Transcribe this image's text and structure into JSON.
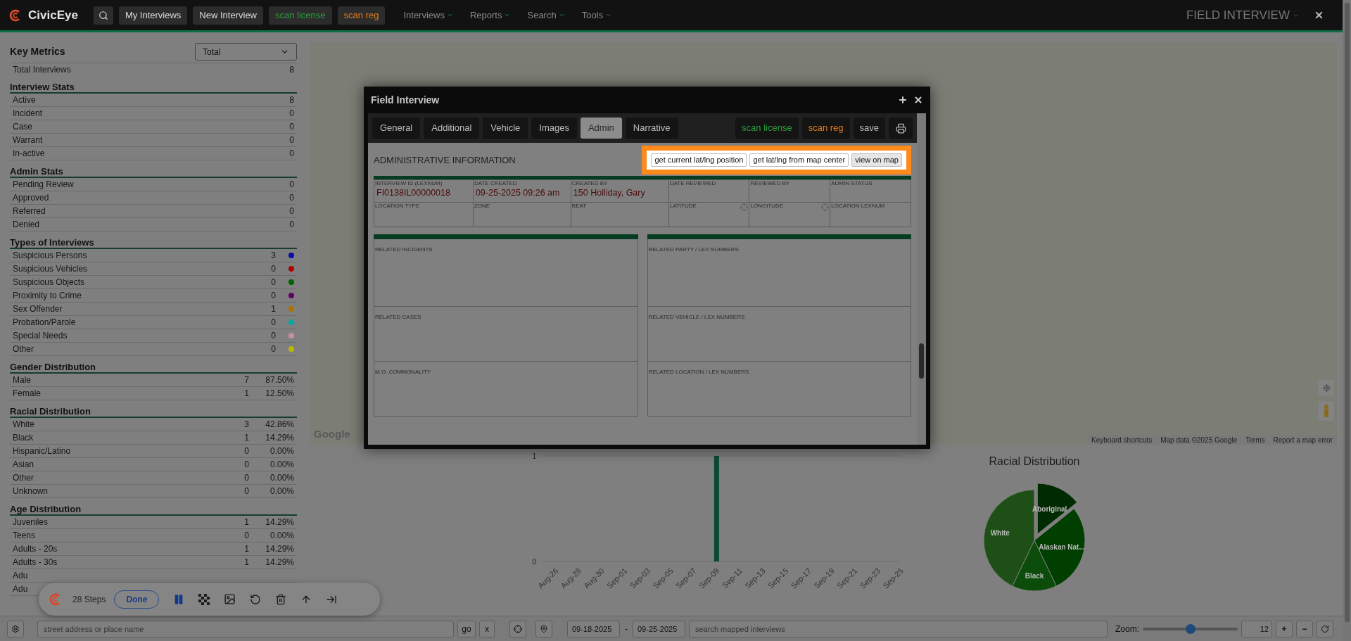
{
  "top_bar": {
    "logo": "CivicEye",
    "buttons": [
      {
        "label": "My Interviews"
      },
      {
        "label": "New Interview"
      },
      {
        "label": "scan license",
        "color": "#2e9e3e"
      },
      {
        "label": "scan reg",
        "color": "#e07b1a"
      }
    ],
    "menus": [
      "Interviews",
      "Reports",
      "Search",
      "Tools"
    ],
    "title": "FIELD INTERVIEW"
  },
  "metrics": {
    "title": "Key Metrics",
    "filter": "Total",
    "total": {
      "label": "Total Interviews",
      "count": "8"
    },
    "sections": [
      {
        "title": "Interview Stats",
        "rows": [
          {
            "label": "Active",
            "count": "8"
          },
          {
            "label": "Incident",
            "count": "0"
          },
          {
            "label": "Case",
            "count": "0"
          },
          {
            "label": "Warrant",
            "count": "0"
          },
          {
            "label": "In-active",
            "count": "0"
          }
        ]
      },
      {
        "title": "Admin Stats",
        "rows": [
          {
            "label": "Pending Review",
            "count": "0"
          },
          {
            "label": "Approved",
            "count": "0"
          },
          {
            "label": "Referred",
            "count": "0"
          },
          {
            "label": "Denied",
            "count": "0"
          }
        ]
      },
      {
        "title": "Types of Interviews",
        "rows": [
          {
            "label": "Suspicious Persons",
            "count": "3",
            "color": "#0a0aa8"
          },
          {
            "label": "Suspicious Vehicles",
            "count": "0",
            "color": "#b00000"
          },
          {
            "label": "Suspicious Objects",
            "count": "0",
            "color": "#006400"
          },
          {
            "label": "Proximity to Crime",
            "count": "0",
            "color": "#640064"
          },
          {
            "label": "Sex Offender",
            "count": "1",
            "color": "#b07000"
          },
          {
            "label": "Probation/Parole",
            "count": "0",
            "color": "#00a8a8"
          },
          {
            "label": "Special Needs",
            "count": "0",
            "color": "#c890a0"
          },
          {
            "label": "Other",
            "count": "0",
            "color": "#b8b800"
          }
        ]
      },
      {
        "title": "Gender Distribution",
        "rows": [
          {
            "label": "Male",
            "count": "7",
            "percent": "87.50%"
          },
          {
            "label": "Female",
            "count": "1",
            "percent": "12.50%"
          }
        ]
      },
      {
        "title": "Racial Distribution",
        "rows": [
          {
            "label": "White",
            "count": "3",
            "percent": "42.86%"
          },
          {
            "label": "Black",
            "count": "1",
            "percent": "14.29%"
          },
          {
            "label": "Hispanic/Latino",
            "count": "0",
            "percent": "0.00%"
          },
          {
            "label": "Asian",
            "count": "0",
            "percent": "0.00%"
          },
          {
            "label": "Other",
            "count": "0",
            "percent": "0.00%"
          },
          {
            "label": "Unknown",
            "count": "0",
            "percent": "0.00%"
          }
        ]
      },
      {
        "title": "Age Distribution",
        "rows": [
          {
            "label": "Juveniles",
            "count": "1",
            "percent": "14.29%"
          },
          {
            "label": "Teens",
            "count": "0",
            "percent": "0.00%"
          },
          {
            "label": "Adults - 20s",
            "count": "1",
            "percent": "14.29%"
          },
          {
            "label": "Adults - 30s",
            "count": "1",
            "percent": "14.29%"
          },
          {
            "label": "Adu"
          },
          {
            "label": "Adu"
          }
        ]
      }
    ]
  },
  "map": {
    "logo": "Google",
    "attribution": [
      "Keyboard shortcuts",
      "Map data ©2025 Google",
      "Terms",
      "Report a map error"
    ]
  },
  "dialog": {
    "title": "Field Interview",
    "tabs": [
      {
        "label": "General",
        "selected": false
      },
      {
        "label": "Additional",
        "selected": false
      },
      {
        "label": "Vehicle",
        "selected": false
      },
      {
        "label": "Images",
        "selected": false
      },
      {
        "label": "Admin",
        "selected": true
      },
      {
        "label": "Narrative",
        "selected": false
      }
    ],
    "actions": [
      {
        "label": "scan license",
        "color": "#2e9e3e"
      },
      {
        "label": "scan reg",
        "color": "#e07b1a"
      },
      {
        "label": "save"
      }
    ],
    "section_title": "ADMINISTRATIVE INFORMATION",
    "highlight_buttons": [
      "get current lat/lng position",
      "get lat/lng from map center",
      "view on map"
    ],
    "fields_row1": [
      {
        "label": "INTERVIEW ID (LEXNUM)",
        "value": "FI0138IL00000018"
      },
      {
        "label": "DATE CREATED",
        "value": "09-25-2025 09:26 am"
      },
      {
        "label": "CREATED BY",
        "value": "150 Holliday, Gary"
      },
      {
        "label": "DATE REVIEWED"
      },
      {
        "label": "REVIEWED BY"
      },
      {
        "label": "ADMIN STATUS"
      }
    ],
    "fields_row2": [
      {
        "label": "LOCATION TYPE",
        "locate": false
      },
      {
        "label": "ZONE",
        "locate": false
      },
      {
        "label": "BEAT",
        "locate": false
      },
      {
        "label": "LATITUDE",
        "locate": true
      },
      {
        "label": "LONGITUDE",
        "locate": true
      },
      {
        "label": "LOCATION LEXNUM",
        "locate": false
      }
    ],
    "left_boxes": [
      "RELATED INCIDENTS",
      "RELATED CASES",
      "M.O. COMMONALITY"
    ],
    "right_boxes": [
      "RELATED PARTY / LEX NUMBERS",
      "RELATED VEHICLE / LEX NUMBERS",
      "RELATED LOCATION / LEX NUMBERS"
    ]
  },
  "activity_chart": {
    "chart_data": {
      "type": "bar",
      "categories": [
        "Aug-26",
        "Aug-28",
        "Aug-30",
        "Sep-01",
        "Sep-03",
        "Sep-05",
        "Sep-07",
        "Sep-09",
        "Sep-11",
        "Sep-13",
        "Sep-15",
        "Sep-17",
        "Sep-19",
        "Sep-21",
        "Sep-23",
        "Sep-25"
      ],
      "values": [
        0,
        0,
        0,
        0,
        0,
        0,
        0,
        1,
        0,
        0,
        0,
        0,
        0,
        0,
        0,
        0
      ],
      "ylim": [
        0,
        1
      ],
      "yticks": [
        0,
        1
      ]
    }
  },
  "racial_chart": {
    "chart_data": {
      "type": "pie",
      "title": "Racial Distribution",
      "categories": [
        "Aboriginal",
        "Alaskan Nat...",
        "Black",
        "White"
      ],
      "values": [
        14.28,
        28.57,
        14.29,
        42.86
      ]
    }
  },
  "steps_bar": {
    "steps": "28 Steps",
    "done": "Done"
  },
  "bottom_bar": {
    "address_placeholder": "street address or place name",
    "go": "go",
    "clear": "x",
    "date_from": "09-18-2025",
    "date_sep": "-",
    "date_to": "09-25-2025",
    "search_placeholder": "search mapped interviews",
    "zoom_label": "Zoom:",
    "zoom": {
      "level": 0.5
    },
    "zoom_value": "12",
    "zoom_in": "+",
    "zoom_out": "−"
  }
}
